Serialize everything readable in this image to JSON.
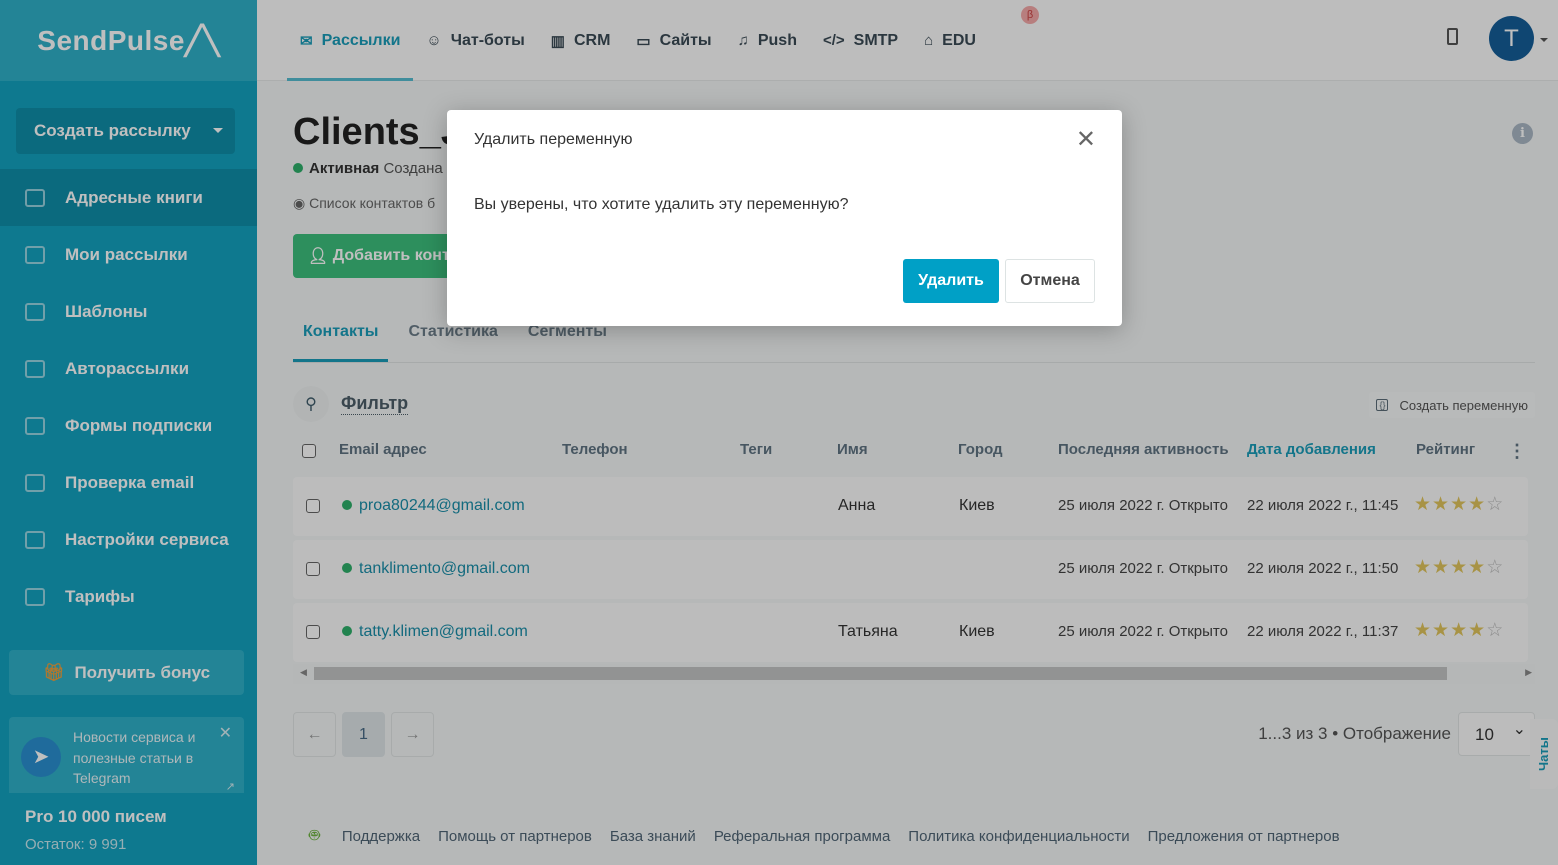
{
  "sidebar": {
    "logo": "SendPulse",
    "create_label": "Создать рассылку",
    "items": [
      {
        "label": "Адресные книги",
        "active": true
      },
      {
        "label": "Мои рассылки"
      },
      {
        "label": "Шаблоны"
      },
      {
        "label": "Авторассылки"
      },
      {
        "label": "Формы подписки"
      },
      {
        "label": "Проверка email"
      },
      {
        "label": "Настройки сервиса"
      },
      {
        "label": "Тарифы"
      }
    ],
    "bonus_label": "Получить бонус",
    "telegram_text": "Новости сервиса и полезные статьи в Telegram",
    "plan": "Pro 10 000 писем",
    "remaining": "Остаток: 9 991"
  },
  "topnav": {
    "tabs": [
      {
        "label": "Рассылки",
        "icon": "envelope-icon"
      },
      {
        "label": "Чат-боты",
        "icon": "chat-bot-icon"
      },
      {
        "label": "CRM",
        "icon": "crm-icon"
      },
      {
        "label": "Сайты",
        "icon": "site-icon"
      },
      {
        "label": "Push",
        "icon": "bell-icon"
      },
      {
        "label": "SMTP",
        "icon": "code-icon"
      },
      {
        "label": "EDU",
        "icon": "graduation-cap-icon"
      }
    ],
    "beta_badge": "β",
    "avatar_letter": "T"
  },
  "page": {
    "title": "Clients_Ju",
    "status": "Активная",
    "created": "Создана",
    "list_note": "Список контактов б",
    "add_contact_label": "Добавить конт",
    "subtabs": [
      "Контакты",
      "Статистика",
      "Сегменты"
    ],
    "filter_label": "Фильтр",
    "create_variable_label": "Создать переменную"
  },
  "table": {
    "headers": [
      "Email адрес",
      "Телефон",
      "Теги",
      "Имя",
      "Город",
      "Последняя активность",
      "Дата добавления",
      "Рейтинг"
    ],
    "rows": [
      {
        "email": "proa80244@gmail.com",
        "phone": "",
        "tags": "",
        "name": "Анна",
        "city": "Киев",
        "last_activity": "25 июля 2022 г. Открыто",
        "added": "22 июля 2022 г., 11:45",
        "rating": 4
      },
      {
        "email": "tanklimento@gmail.com",
        "phone": "",
        "tags": "",
        "name": "",
        "city": "",
        "last_activity": "25 июля 2022 г. Открыто",
        "added": "22 июля 2022 г., 11:50",
        "rating": 4
      },
      {
        "email": "tatty.klimen@gmail.com",
        "phone": "",
        "tags": "",
        "name": "Татьяна",
        "city": "Киев",
        "last_activity": "25 июля 2022 г. Открыто",
        "added": "22 июля 2022 г., 11:37",
        "rating": 4
      }
    ]
  },
  "pagination": {
    "prev": "←",
    "current": "1",
    "next": "→",
    "count": "1...3 из 3",
    "display_label": "Отображение",
    "page_size": "10"
  },
  "chats_label": "Чаты",
  "footer": {
    "links": [
      "Поддержка",
      "Помощь от партнеров",
      "База знаний",
      "Реферальная программа",
      "Политика конфиденциальности",
      "Предложения от партнеров"
    ]
  },
  "modal": {
    "title": "Удалить переменную",
    "body": "Вы уверены, что хотите удалить эту переменную?",
    "confirm_label": "Удалить",
    "cancel_label": "Отмена"
  }
}
